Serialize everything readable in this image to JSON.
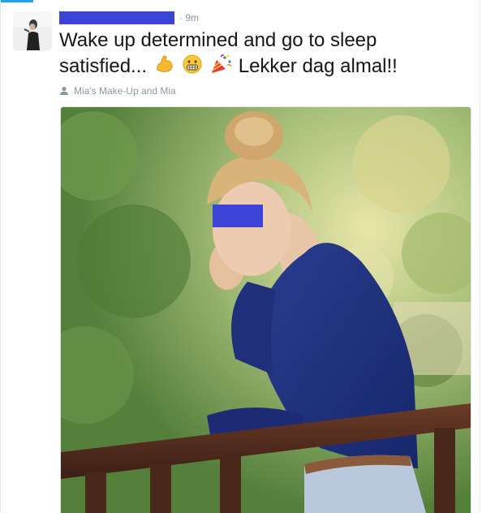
{
  "tweet": {
    "time": "9m",
    "text_main": "Wake up determined and go to sleep satisfied...",
    "emojis": [
      "flexed-biceps",
      "grimacing-face",
      "party-popper"
    ],
    "text_after": "Lekker dag almal!!",
    "tagged_user": "Mia's Make-Up and Mia"
  },
  "colors": {
    "accent": "#1da1f2",
    "redaction": "#3b44d6",
    "meta_text": "#8899a6",
    "body_text": "#14171a"
  },
  "icons": {
    "tag": "person-icon"
  }
}
